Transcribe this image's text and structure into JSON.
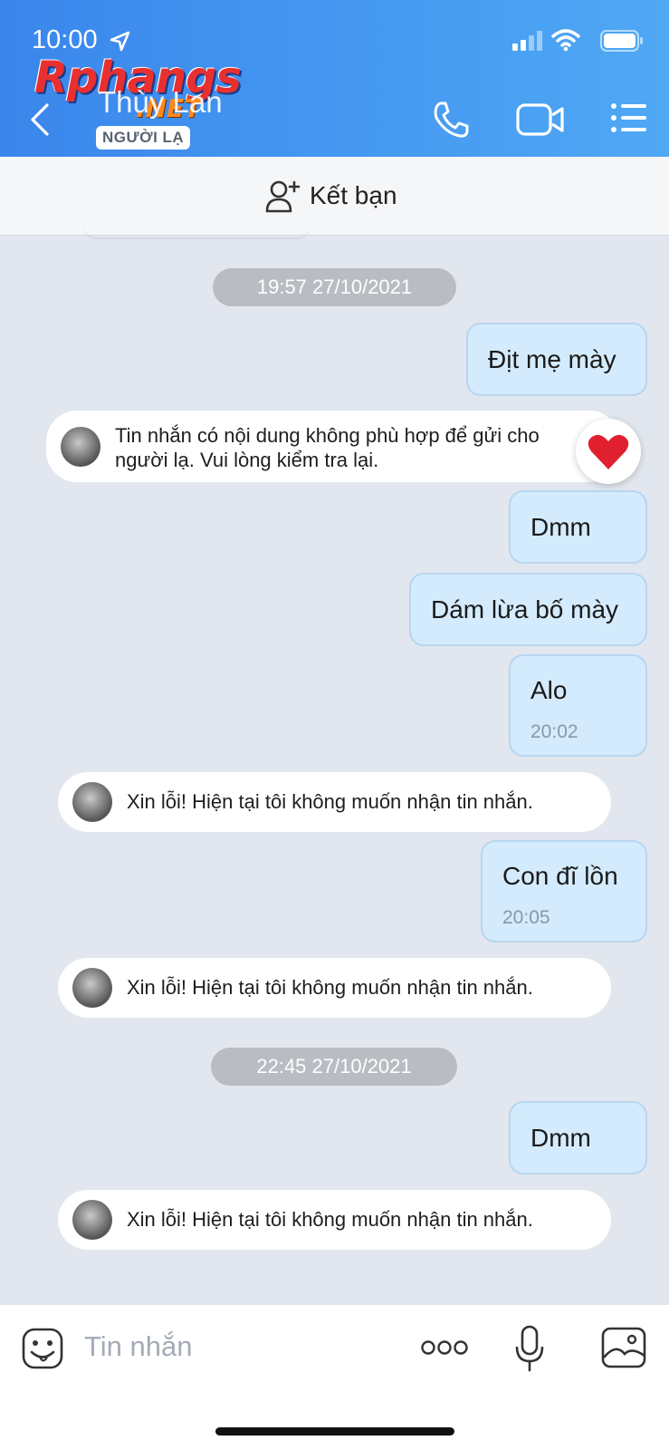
{
  "status_bar": {
    "time": "10:00"
  },
  "watermark": {
    "main": "Rphangs",
    "suffix": ".NET"
  },
  "header": {
    "contact_name": "Thùy Lan",
    "badge": "NGƯỜI LẠ"
  },
  "add_friend": {
    "label": "Kết bạn"
  },
  "messages": {
    "date1": "19:57 27/10/2021",
    "out1": "Địt mẹ mày",
    "sys1_line1": "Tin nhắn có nội dung không phù hợp để gửi cho",
    "sys1_line2": "người lạ. Vui lòng kiểm tra lại.",
    "out2": "Dmm",
    "out3": "Dám lừa bố mày",
    "out4": "Alo",
    "out4_time": "20:02",
    "sys2": "Xin lỗi! Hiện tại tôi không muốn nhận tin nhắn.",
    "out5": "Con đĩ lồn",
    "out5_time": "20:05",
    "sys3": "Xin lỗi! Hiện tại tôi không muốn nhận tin nhắn.",
    "date2": "22:45 27/10/2021",
    "out6": "Dmm",
    "sys4": "Xin lỗi! Hiện tại tôi không muốn nhận tin nhắn."
  },
  "input": {
    "placeholder": "Tin nhắn"
  },
  "colors": {
    "header_start": "#3a86ec",
    "header_end": "#4fa8f4",
    "bubble_out": "#d4ebfd",
    "chat_bg": "#e2e6ee"
  },
  "icons": [
    "location-arrow-icon",
    "signal-icon",
    "wifi-icon",
    "battery-icon",
    "back-icon",
    "phone-icon",
    "video-icon",
    "menu-icon",
    "add-friend-icon",
    "heart-icon",
    "sticker-icon",
    "more-icon",
    "mic-icon",
    "image-icon"
  ]
}
